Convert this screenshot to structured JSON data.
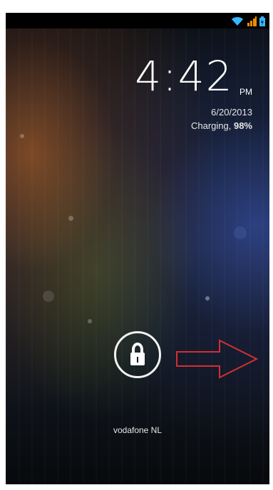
{
  "status_bar": {
    "icons": [
      "wifi-icon",
      "signal-icon",
      "battery-charging-icon"
    ],
    "signal_color": "#f08a00",
    "wifi_color": "#38b6ff",
    "battery_color": "#38b6ff"
  },
  "lockscreen": {
    "time": "4:42",
    "ampm": "PM",
    "date": "6/20/2013",
    "charging_prefix": "Charging, ",
    "charging_percent": "98%",
    "carrier": "vodafone NL"
  },
  "unlock": {
    "icon": "padlock-icon",
    "hint_arrow_color": "#d32f2f",
    "hint_direction": "right"
  }
}
